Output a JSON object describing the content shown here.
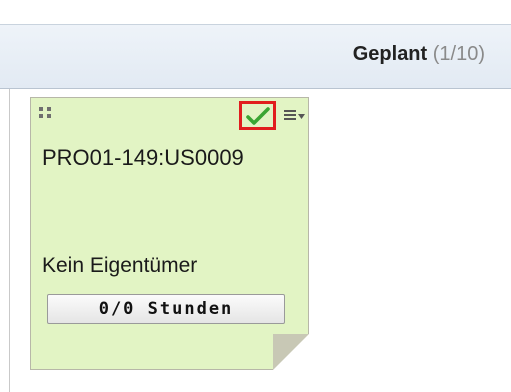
{
  "column": {
    "title": "Geplant",
    "count": "(1/10)"
  },
  "card": {
    "id": "PRO01-149:US0009",
    "owner": "Kein Eigentümer",
    "hours_button": "0/0 Stunden",
    "icons": {
      "drag": "drag-handle-icon",
      "done": "checkmark-icon",
      "menu": "menu-dropdown-icon"
    }
  },
  "colors": {
    "card_background": "#e2f4c4",
    "check_highlight": "#e11e1e",
    "check_green": "#3aa533",
    "header_background": "#e6edf5"
  }
}
